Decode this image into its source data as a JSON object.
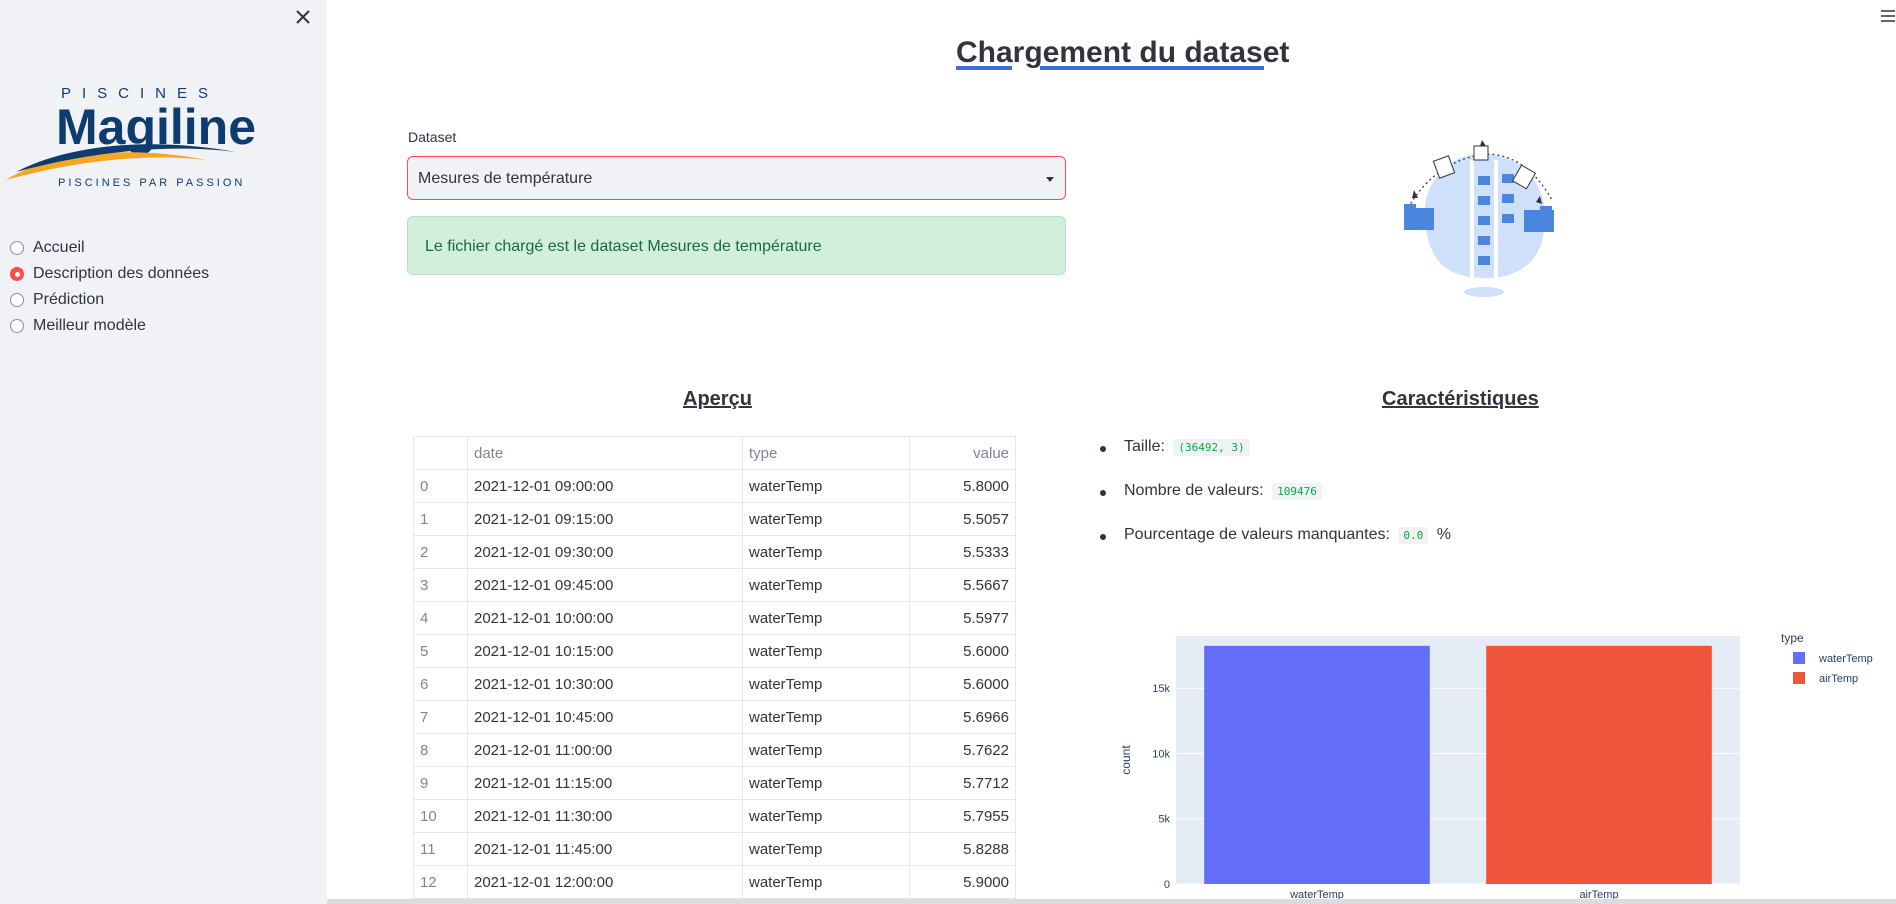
{
  "sidebar": {
    "logo": {
      "top_text": "PISCINES",
      "brand": "Magiline",
      "tagline": "PISCINES PAR PASSION"
    },
    "items": [
      {
        "label": "Accueil",
        "checked": false
      },
      {
        "label": "Description des données",
        "checked": true
      },
      {
        "label": "Prédiction",
        "checked": false
      },
      {
        "label": "Meilleur modèle",
        "checked": false
      }
    ]
  },
  "main": {
    "title": "Chargement du dataset",
    "dataset_label": "Dataset",
    "dataset_value": "Mesures de température",
    "alert": "Le fichier chargé est le dataset Mesures de température",
    "apercu_title": "Aperçu",
    "carac_title": "Caractéristiques",
    "table": {
      "columns": [
        "",
        "date",
        "type",
        "value"
      ],
      "rows": [
        [
          "0",
          "2021-12-01 09:00:00",
          "waterTemp",
          "5.8000"
        ],
        [
          "1",
          "2021-12-01 09:15:00",
          "waterTemp",
          "5.5057"
        ],
        [
          "2",
          "2021-12-01 09:30:00",
          "waterTemp",
          "5.5333"
        ],
        [
          "3",
          "2021-12-01 09:45:00",
          "waterTemp",
          "5.5667"
        ],
        [
          "4",
          "2021-12-01 10:00:00",
          "waterTemp",
          "5.5977"
        ],
        [
          "5",
          "2021-12-01 10:15:00",
          "waterTemp",
          "5.6000"
        ],
        [
          "6",
          "2021-12-01 10:30:00",
          "waterTemp",
          "5.6000"
        ],
        [
          "7",
          "2021-12-01 10:45:00",
          "waterTemp",
          "5.6966"
        ],
        [
          "8",
          "2021-12-01 11:00:00",
          "waterTemp",
          "5.7622"
        ],
        [
          "9",
          "2021-12-01 11:15:00",
          "waterTemp",
          "5.7712"
        ],
        [
          "10",
          "2021-12-01 11:30:00",
          "waterTemp",
          "5.7955"
        ],
        [
          "11",
          "2021-12-01 11:45:00",
          "waterTemp",
          "5.8288"
        ],
        [
          "12",
          "2021-12-01 12:00:00",
          "waterTemp",
          "5.9000"
        ]
      ]
    },
    "characteristics": [
      {
        "label": "Taille:",
        "code": "(36492, 3)",
        "suffix": ""
      },
      {
        "label": "Nombre de valeurs:",
        "code": "109476",
        "suffix": ""
      },
      {
        "label": "Pourcentage de valeurs manquantes:",
        "code": "0.0",
        "suffix": "%"
      }
    ]
  },
  "colors": {
    "accent": "#ff4b4b",
    "water": "#636efa",
    "air": "#ef553b",
    "success_bg": "#d2eedc"
  },
  "chart_data": {
    "type": "bar",
    "categories": [
      "waterTemp",
      "airTemp"
    ],
    "values": [
      18246,
      18246
    ],
    "ylabel": "count",
    "ylim": [
      0,
      19000
    ],
    "yticks": [
      0,
      5000,
      10000,
      15000
    ],
    "ytick_labels": [
      "0",
      "5k",
      "10k",
      "15k"
    ],
    "legend_title": "type",
    "legend": [
      "waterTemp",
      "airTemp"
    ],
    "series_colors": [
      "#636efa",
      "#ef553b"
    ],
    "grid": true
  }
}
